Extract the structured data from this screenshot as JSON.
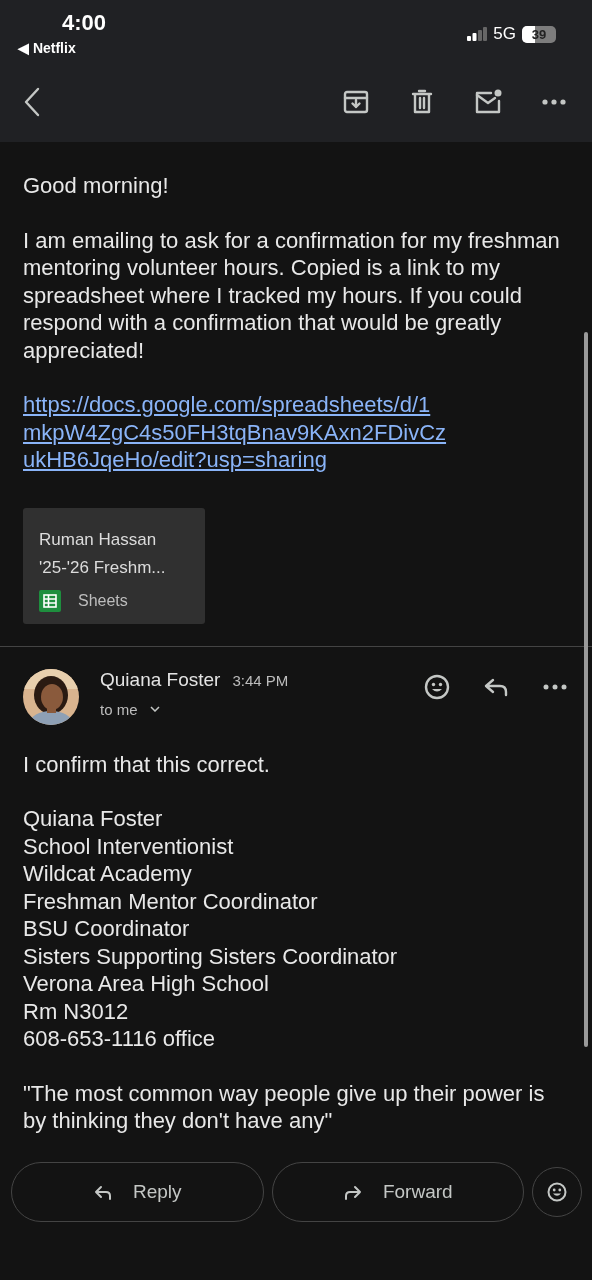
{
  "status_bar": {
    "time": "4:00",
    "back_app": "◀ Netflix",
    "network": "5G",
    "battery": "39"
  },
  "toolbar": {
    "actions": [
      {
        "kind": "archive"
      },
      {
        "kind": "delete"
      },
      {
        "kind": "mark-unread"
      },
      {
        "kind": "more"
      }
    ]
  },
  "first_message": {
    "paragraphs": [
      "Good morning!",
      "I am emailing to ask for a confirmation for my freshman mentoring volunteer hours. Copied is a link to my spreadsheet where I tracked my hours. If you could respond with a confirmation that would be greatly appreciated!"
    ],
    "link": "https://docs.google.com/spreadsheets/d/1mkpW4ZgC4s50FH3tqBnav9KAxn2FDivCzukHB6JqeHo/edit?usp=sharing",
    "attachment": {
      "title_lines": [
        "Ruman Hassan",
        "'25-'26 Freshm..."
      ],
      "app": "Sheets"
    }
  },
  "second_message": {
    "sender": "Quiana Foster",
    "time": "3:44 PM",
    "recipient": "to me",
    "body": "I confirm that this correct.",
    "signature": [
      "Quiana Foster",
      "School Interventionist",
      "Wildcat Academy",
      "Freshman Mentor Coordinator",
      "BSU Coordinator",
      "Sisters Supporting Sisters Coordinator",
      "Verona Area High School",
      "Rm N3012",
      "608-653-1116 office"
    ],
    "quote": "\"The most common way people give up their power is by thinking they don't have any\""
  },
  "bottom_actions": [
    {
      "kind": "reply",
      "label": "Reply"
    },
    {
      "kind": "forward",
      "label": "Forward"
    },
    {
      "kind": "emoji"
    }
  ]
}
